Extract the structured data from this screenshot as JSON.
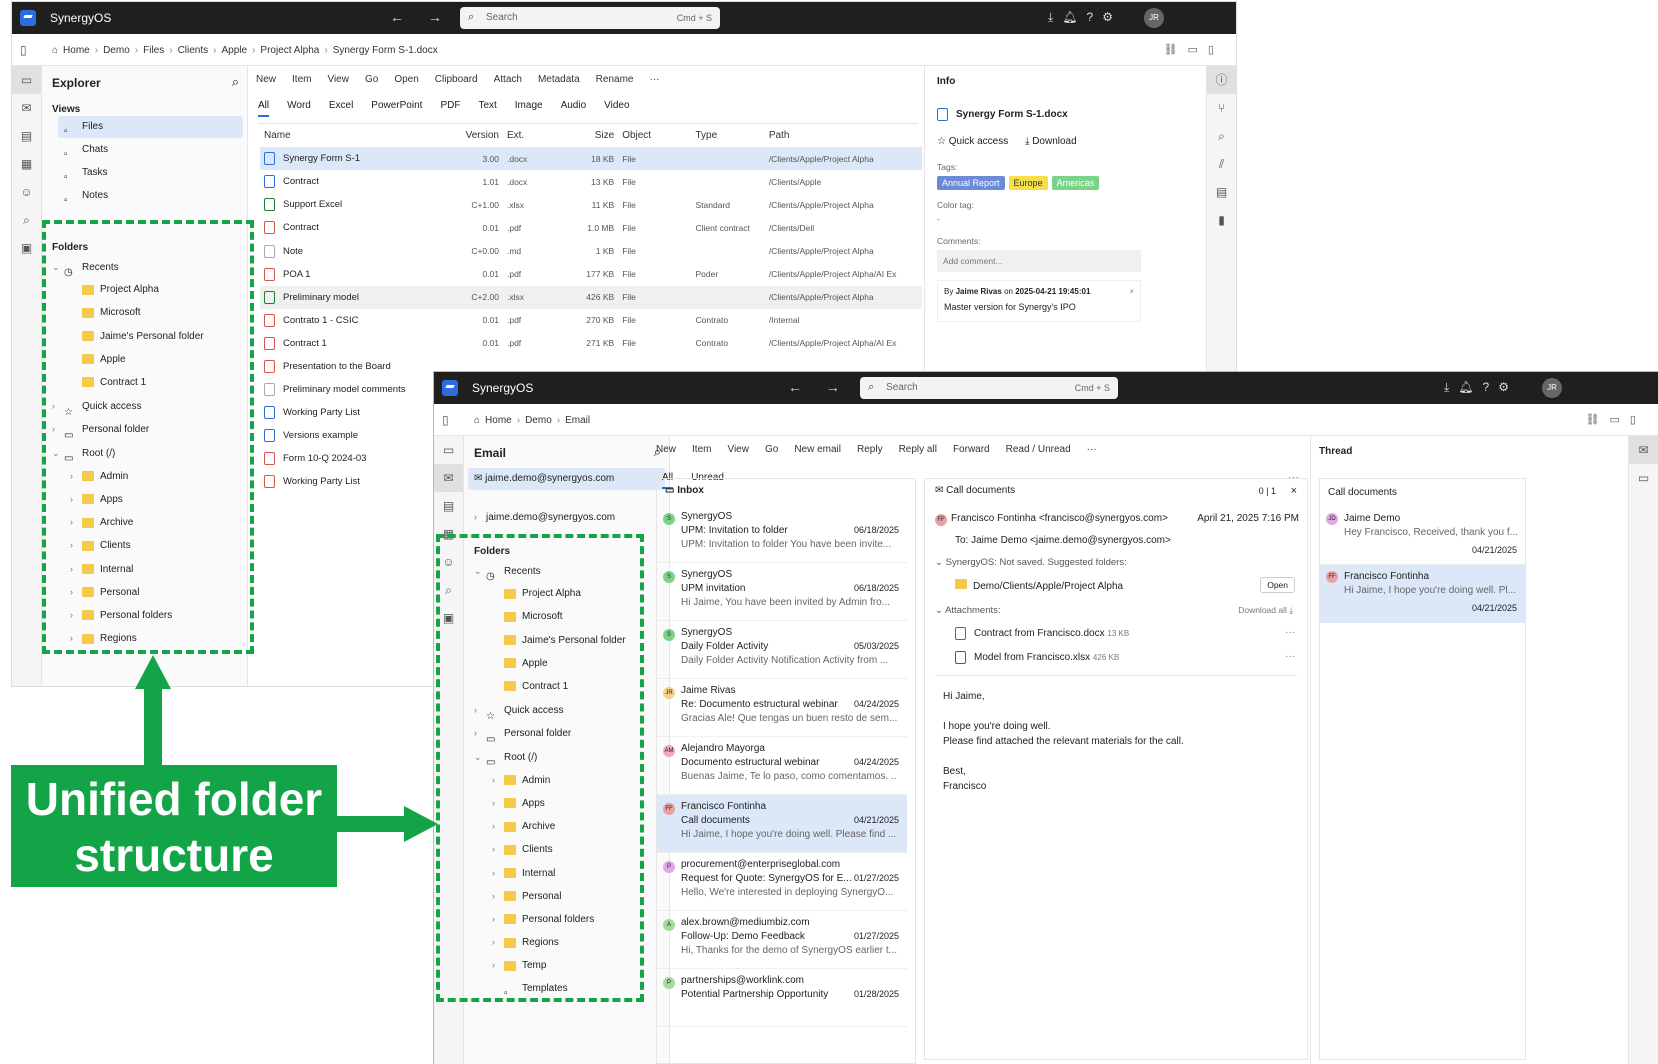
{
  "app": {
    "name": "SynergyOS",
    "search_placeholder": "Search",
    "search_kbd": "Cmd + S",
    "avatar": "JR"
  },
  "w1": {
    "breadcrumb": [
      "Home",
      "Demo",
      "Files",
      "Clients",
      "Apple",
      "Project Alpha",
      "Synergy Form S-1.docx"
    ],
    "explorer": {
      "title": "Explorer",
      "views_label": "Views",
      "views": [
        "Files",
        "Chats",
        "Tasks",
        "Notes"
      ],
      "folders_label": "Folders",
      "folders": [
        {
          "n": "Recents",
          "lvl": 0,
          "type": "clock",
          "chev": "v"
        },
        {
          "n": "Project Alpha",
          "lvl": 1,
          "type": "folder"
        },
        {
          "n": "Microsoft",
          "lvl": 1,
          "type": "folder"
        },
        {
          "n": "Jaime's Personal folder",
          "lvl": 1,
          "type": "folder"
        },
        {
          "n": "Apple",
          "lvl": 1,
          "type": "folder"
        },
        {
          "n": "Contract 1",
          "lvl": 1,
          "type": "folder"
        },
        {
          "n": "Quick access",
          "lvl": 0,
          "type": "star",
          "chev": ">"
        },
        {
          "n": "Personal folder",
          "lvl": 0,
          "type": "pfolder",
          "chev": ">"
        },
        {
          "n": "Root (/)",
          "lvl": 0,
          "type": "ofolder",
          "chev": "v"
        },
        {
          "n": "Admin",
          "lvl": 1,
          "type": "folder",
          "chev": ">"
        },
        {
          "n": "Apps",
          "lvl": 1,
          "type": "folder",
          "chev": ">"
        },
        {
          "n": "Archive",
          "lvl": 1,
          "type": "folder",
          "chev": ">"
        },
        {
          "n": "Clients",
          "lvl": 1,
          "type": "folder",
          "chev": ">"
        },
        {
          "n": "Internal",
          "lvl": 1,
          "type": "folder",
          "chev": ">"
        },
        {
          "n": "Personal",
          "lvl": 1,
          "type": "folder",
          "chev": ">"
        },
        {
          "n": "Personal folders",
          "lvl": 1,
          "type": "folder",
          "chev": ">"
        },
        {
          "n": "Regions",
          "lvl": 1,
          "type": "folder",
          "chev": ">"
        }
      ]
    },
    "toolbar": [
      "New",
      "Item",
      "View",
      "Go",
      "Open",
      "Clipboard",
      "Attach",
      "Metadata",
      "Rename",
      "···"
    ],
    "tabs": [
      "All",
      "Word",
      "Excel",
      "PowerPoint",
      "PDF",
      "Text",
      "Image",
      "Audio",
      "Video"
    ],
    "columns": [
      "Name",
      "Version",
      "Ext.",
      "Size",
      "Object",
      "Type",
      "Path"
    ],
    "files": [
      {
        "n": "Synergy Form S-1",
        "v": "3.00",
        "e": ".docx",
        "s": "18 KB",
        "o": "File",
        "t": "",
        "p": "/Clients/Apple/Project Alpha",
        "k": "w"
      },
      {
        "n": "Contract",
        "v": "1.01",
        "e": ".docx",
        "s": "13 KB",
        "o": "File",
        "t": "",
        "p": "/Clients/Apple",
        "k": "w"
      },
      {
        "n": "Support Excel",
        "v": "C+1.00",
        "e": ".xlsx",
        "s": "11 KB",
        "o": "File",
        "t": "Standard",
        "p": "/Clients/Apple/Project Alpha",
        "k": "x"
      },
      {
        "n": "Contract",
        "v": "0.01",
        "e": ".pdf",
        "s": "1.0 MB",
        "o": "File",
        "t": "Client contract",
        "p": "/Clients/Dell",
        "k": "p"
      },
      {
        "n": "Note",
        "v": "C+0.00",
        "e": ".md",
        "s": "1 KB",
        "o": "File",
        "t": "",
        "p": "/Clients/Apple/Project Alpha",
        "k": "m"
      },
      {
        "n": "POA 1",
        "v": "0.01",
        "e": ".pdf",
        "s": "177 KB",
        "o": "File",
        "t": "Poder",
        "p": "/Clients/Apple/Project Alpha/AI Ex",
        "k": "p"
      },
      {
        "n": "Preliminary model",
        "v": "C+2.00",
        "e": ".xlsx",
        "s": "426 KB",
        "o": "File",
        "t": "",
        "p": "/Clients/Apple/Project Alpha",
        "k": "x"
      },
      {
        "n": "Contrato 1 - CSIC",
        "v": "0.01",
        "e": ".pdf",
        "s": "270 KB",
        "o": "File",
        "t": "Contrato",
        "p": "/Internal",
        "k": "p"
      },
      {
        "n": "Contract 1",
        "v": "0.01",
        "e": ".pdf",
        "s": "271 KB",
        "o": "File",
        "t": "Contrato",
        "p": "/Clients/Apple/Project Alpha/AI Ex",
        "k": "p"
      },
      {
        "n": "Presentation to the Board",
        "v": "",
        "e": "",
        "s": "",
        "o": "",
        "t": "",
        "p": "",
        "k": "p"
      },
      {
        "n": "Preliminary model comments",
        "v": "",
        "e": "",
        "s": "",
        "o": "",
        "t": "",
        "p": "",
        "k": "m"
      },
      {
        "n": "Working Party List",
        "v": "",
        "e": "",
        "s": "",
        "o": "",
        "t": "",
        "p": "",
        "k": "w"
      },
      {
        "n": "Versions example",
        "v": "",
        "e": "",
        "s": "",
        "o": "",
        "t": "",
        "p": "",
        "k": "w"
      },
      {
        "n": "Form 10-Q 2024-03",
        "v": "",
        "e": "",
        "s": "",
        "o": "",
        "t": "",
        "p": "",
        "k": "p"
      },
      {
        "n": "Working Party List",
        "v": "",
        "e": "",
        "s": "",
        "o": "",
        "t": "",
        "p": "",
        "k": "p"
      }
    ],
    "info": {
      "title": "Info",
      "file": "Synergy Form S-1.docx",
      "quick": "Quick access",
      "download": "Download",
      "tags_label": "Tags:",
      "tags": [
        {
          "n": "Annual Report",
          "c": "#6b8bd6",
          "f": "#fff"
        },
        {
          "n": "Europe",
          "c": "#f5e04a",
          "f": "#333"
        },
        {
          "n": "Americas",
          "c": "#7bd389",
          "f": "#fff"
        }
      ],
      "color_label": "Color tag:",
      "color_val": "-",
      "comments_label": "Comments:",
      "add_comment": "Add comment...",
      "comment_by": "By",
      "comment_author": "Jaime Rivas",
      "comment_on": "on",
      "comment_date": "2025-04-21 19:45:01",
      "comment_text": "Master version for Synergy's IPO"
    }
  },
  "w2": {
    "breadcrumb": [
      "Home",
      "Demo",
      "Email"
    ],
    "email": {
      "title": "Email",
      "account": "jaime.demo@synergyos.com",
      "account2": "jaime.demo@synergyos.com",
      "folders_label": "Folders",
      "folders": [
        {
          "n": "Recents",
          "lvl": 0,
          "type": "clock",
          "chev": "v"
        },
        {
          "n": "Project Alpha",
          "lvl": 1,
          "type": "folder"
        },
        {
          "n": "Microsoft",
          "lvl": 1,
          "type": "folder"
        },
        {
          "n": "Jaime's Personal folder",
          "lvl": 1,
          "type": "folder"
        },
        {
          "n": "Apple",
          "lvl": 1,
          "type": "folder"
        },
        {
          "n": "Contract 1",
          "lvl": 1,
          "type": "folder"
        },
        {
          "n": "Quick access",
          "lvl": 0,
          "type": "star",
          "chev": ">"
        },
        {
          "n": "Personal folder",
          "lvl": 0,
          "type": "pfolder",
          "chev": ">"
        },
        {
          "n": "Root (/)",
          "lvl": 0,
          "type": "ofolder",
          "chev": "v"
        },
        {
          "n": "Admin",
          "lvl": 1,
          "type": "folder",
          "chev": ">"
        },
        {
          "n": "Apps",
          "lvl": 1,
          "type": "folder",
          "chev": ">"
        },
        {
          "n": "Archive",
          "lvl": 1,
          "type": "folder",
          "chev": ">"
        },
        {
          "n": "Clients",
          "lvl": 1,
          "type": "folder",
          "chev": ">"
        },
        {
          "n": "Internal",
          "lvl": 1,
          "type": "folder",
          "chev": ">"
        },
        {
          "n": "Personal",
          "lvl": 1,
          "type": "folder",
          "chev": ">"
        },
        {
          "n": "Personal folders",
          "lvl": 1,
          "type": "folder",
          "chev": ">"
        },
        {
          "n": "Regions",
          "lvl": 1,
          "type": "folder",
          "chev": ">"
        },
        {
          "n": "Temp",
          "lvl": 1,
          "type": "folder",
          "chev": ">"
        },
        {
          "n": "Templates",
          "lvl": 1,
          "type": "file"
        }
      ]
    },
    "toolbar": [
      "New",
      "Item",
      "View",
      "Go",
      "New email",
      "Reply",
      "Reply all",
      "Forward",
      "Read / Unread",
      "···"
    ],
    "tabs": [
      "All",
      "Unread"
    ],
    "inbox": "Inbox",
    "mails": [
      {
        "s": "SynergyOS",
        "sub": "UPM: Invitation to folder",
        "d": "06/18/2025",
        "p": "UPM: Invitation to folder You have been invite...",
        "a": "S",
        "c": "#7bd389"
      },
      {
        "s": "SynergyOS",
        "sub": "UPM invitation",
        "d": "06/18/2025",
        "p": "Hi Jaime, You have been invited by Admin fro...",
        "a": "S",
        "c": "#7bd389"
      },
      {
        "s": "SynergyOS",
        "sub": "Daily Folder Activity",
        "d": "05/03/2025",
        "p": "Daily Folder Activity Notification Activity from ...",
        "a": "S",
        "c": "#7bd389"
      },
      {
        "s": "Jaime Rivas",
        "sub": "Re: Documento estructural webinar",
        "d": "04/24/2025",
        "p": "Gracias Ale! Que tengas un buen resto de sem...",
        "a": "JR",
        "c": "#f5d08a"
      },
      {
        "s": "Alejandro Mayorga",
        "sub": "Documento estructural webinar",
        "d": "04/24/2025",
        "p": "Buenas Jaime, Te lo paso, como comentamos. ...",
        "a": "AM",
        "c": "#f2a7c8"
      },
      {
        "s": "Francisco Fontinha",
        "sub": "Call documents",
        "d": "04/21/2025",
        "p": "Hi Jaime, I hope you're doing well. Please find ...",
        "a": "FF",
        "c": "#e8a0a0"
      },
      {
        "s": "procurement@enterpriseglobal.com",
        "sub": "Request for Quote: SynergyOS for E...",
        "d": "01/27/2025",
        "p": "Hello, We're interested in deploying SynergyO...",
        "a": "P",
        "c": "#e0a8e8"
      },
      {
        "s": "alex.brown@mediumbiz.com",
        "sub": "Follow-Up: Demo Feedback",
        "d": "01/27/2025",
        "p": "Hi, Thanks for the demo of SynergyOS earlier t...",
        "a": "A",
        "c": "#a8d8a0"
      },
      {
        "s": "partnerships@worklink.com",
        "sub": "Potential Partnership Opportunity",
        "d": "01/28/2025",
        "p": "",
        "a": "P",
        "c": "#a8d8a0"
      }
    ],
    "reader": {
      "title": "Call documents",
      "count1": "0",
      "count2": "1",
      "from": "Francisco Fontinha <francisco@synergyos.com>",
      "date": "April 21, 2025 7:16 PM",
      "to_label": "To:",
      "to": "Jaime Demo <jaime.demo@synergyos.com>",
      "synergy": "SynergyOS:",
      "saved": "Not saved. Suggested folders:",
      "folder": "Demo/Clients/Apple/Project Alpha",
      "open": "Open",
      "attach_label": "Attachments:",
      "download_all": "Download all",
      "att1": "Contract from Francisco.docx",
      "att1s": "13 KB",
      "att2": "Model from Francisco.xlsx",
      "att2s": "426 KB",
      "body": [
        "Hi Jaime,",
        "",
        "I hope you're doing well.",
        "Please find attached the relevant materials for the call.",
        "",
        "Best,",
        "Francisco"
      ]
    },
    "thread": {
      "title": "Thread",
      "subject": "Call documents",
      "items": [
        {
          "n": "Jaime Demo",
          "p": "Hey Francisco, Received, thank you f...",
          "d": "04/21/2025",
          "a": "JD",
          "c": "#e0a8e8"
        },
        {
          "n": "Francisco Fontinha",
          "p": "Hi Jaime, I hope you're doing well. Pl...",
          "d": "04/21/2025",
          "a": "FF",
          "c": "#e8a0a0"
        }
      ]
    }
  },
  "callout": {
    "line1": "Unified folder",
    "line2": "structure"
  }
}
